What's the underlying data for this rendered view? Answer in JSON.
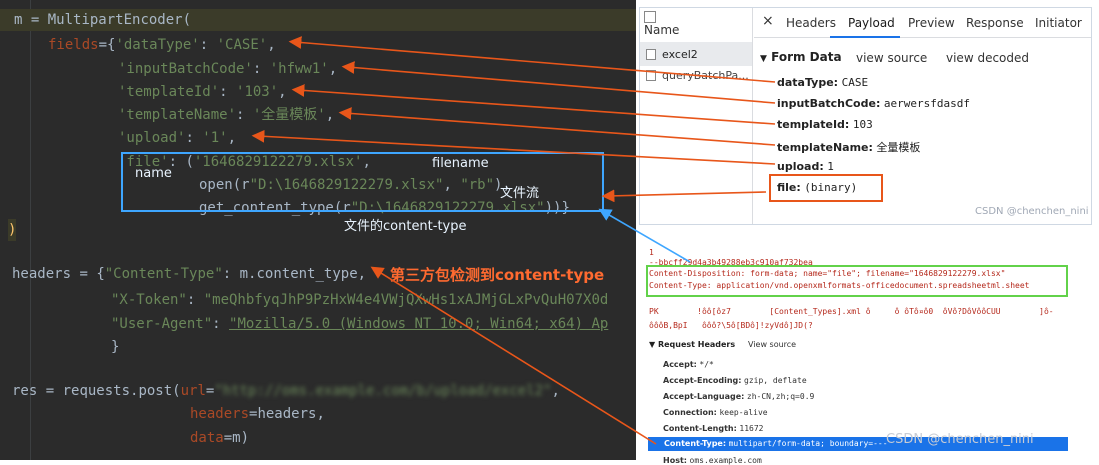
{
  "code": {
    "line1": {
      "var": "m",
      "eq": " = ",
      "fn": "MultipartEncoder",
      "open": "("
    },
    "line2": {
      "param": "fields",
      "eq": "=",
      "open": "{",
      "key": "'dataType'",
      "colon": ": ",
      "val": "'CASE'",
      "comma": ","
    },
    "line3": {
      "key": "'inputBatchCode'",
      "colon": ": ",
      "val": "'hfww1'",
      "comma": ","
    },
    "line4": {
      "key": "'templateId'",
      "colon": ": ",
      "val": "'103'",
      "comma": ","
    },
    "line5": {
      "key": "'templateName'",
      "colon": ": ",
      "val": "'全量模板'",
      "comma": ","
    },
    "line6": {
      "key": "'upload'",
      "colon": ": ",
      "val": "'1'",
      "comma": ","
    },
    "line7": {
      "key": "'file'",
      "colon": ": ",
      "open": "(",
      "val": "'1646829122279.xlsx'",
      "comma": ","
    },
    "line8": {
      "fn": "open",
      "open": "(",
      "pre": "r",
      "val": "\"D:\\1646829122279.xlsx\"",
      "sep": ", ",
      "mode": "\"rb\"",
      "close": "),"
    },
    "line9": {
      "fn": "get_content_type",
      "open": "(",
      "pre": "r",
      "val": "\"D:\\1646829122279.xlsx\"",
      "close": "))}"
    },
    "line10": {
      "close": ")"
    },
    "line12": {
      "var": "headers",
      "eq": " = ",
      "open": "{",
      "key": "\"Content-Type\"",
      "colon": ": ",
      "val": "m.content_type",
      "comma": ","
    },
    "line13": {
      "key": "\"X-Token\"",
      "colon": ": ",
      "val": "\"meQhbfyqJhP9PzHxW4e4VWjQXwHs1xAJMjGLxPvQuH07X0d"
    },
    "line14": {
      "key": "\"User-Agent\"",
      "colon": ": ",
      "val": "\"Mozilla/5.0 (Windows NT 10.0; Win64; x64) Ap"
    },
    "line15": {
      "close": "}"
    },
    "line17": {
      "var": "res",
      "eq": " = ",
      "fn": "requests.post",
      "open": "(",
      "param": "url",
      "peq": "=",
      "val": "\"http://oms.example.com/b/upload/excel2\"",
      "comma": ","
    },
    "line18": {
      "param": "headers",
      "peq": "=",
      "val": "headers",
      "comma": ","
    },
    "line19": {
      "param": "data",
      "peq": "=",
      "val": "m",
      "close": ")"
    }
  },
  "annotations": {
    "name": "name",
    "filename": "filename",
    "file_stream": "文件流",
    "file_content_type": "文件的content-type",
    "third_party": "第三方包检测到content-type"
  },
  "devtools": {
    "name_header": "Name",
    "requests": [
      "excel2",
      "queryBatchPa..."
    ],
    "close": "×",
    "tabs": [
      "Headers",
      "Payload",
      "Preview",
      "Response",
      "Initiator"
    ],
    "form_data_title": "Form Data",
    "view_source": "view source",
    "view_decoded": "view decoded",
    "fields": [
      {
        "key": "dataType:",
        "value": "CASE"
      },
      {
        "key": "inputBatchCode:",
        "value": "aerwersfdasdf"
      },
      {
        "key": "templateId:",
        "value": "103"
      },
      {
        "key": "templateName:",
        "value": "全量模板"
      },
      {
        "key": "upload:",
        "value": "1"
      },
      {
        "key": "file:",
        "value": "(binary)"
      }
    ],
    "watermark": "CSDN @chenchen_nini"
  },
  "payload": {
    "line1": "1",
    "line2": "--bbcff29d4a3b49288eb3c910af732bea",
    "line3": "Content-Disposition: form-data; name=\"file\"; filename=\"1646829122279.xlsx\"",
    "line4": "Content-Type: application/vnd.openxmlformats-officedocument.spreadsheetml.sheet",
    "line5": "PK        !ôô[ôz7        [Content_Types].xml ô     ô ôTô¤ô0  ôVô?DôVôôCUU        ]ô-",
    "line6": "ôôôB,BpI   ôôô?\\5ô[BDô]!zyVdô]JD(?",
    "request_headers_title": "Request Headers",
    "view_source": "View source",
    "headers": [
      {
        "key": "Accept:",
        "value": "*/*"
      },
      {
        "key": "Accept-Encoding:",
        "value": "gzip, deflate"
      },
      {
        "key": "Accept-Language:",
        "value": "zh-CN,zh;q=0.9"
      },
      {
        "key": "Connection:",
        "value": "keep-alive"
      },
      {
        "key": "Content-Length:",
        "value": "11672"
      },
      {
        "key": "Content-Type:",
        "value": "multipart/form-data; boundary=---"
      },
      {
        "key": "Host:",
        "value": "oms.example.com"
      }
    ],
    "watermark": "CSDN @chenchen_nini"
  },
  "colors": {
    "code_bg": "#2b2b2b",
    "annotation_arrow": "#e8561a",
    "blue_box": "#3ea6ff",
    "green_box": "#62d24a",
    "selected_row": "#1a73e8"
  }
}
